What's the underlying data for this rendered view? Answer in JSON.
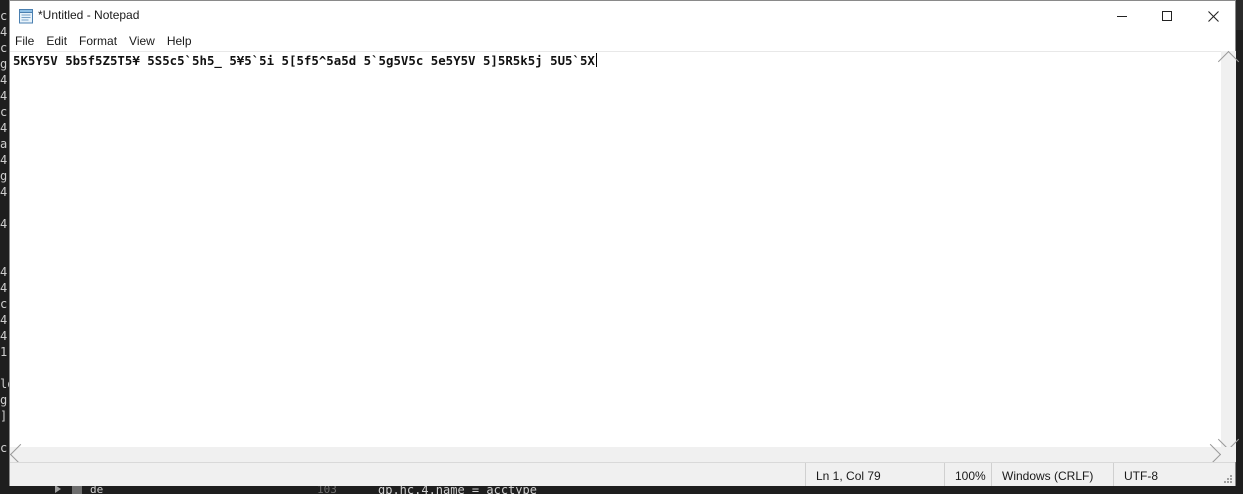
{
  "window": {
    "title": "*Untitled - Notepad"
  },
  "menu": {
    "items": [
      "File",
      "Edit",
      "Format",
      "View",
      "Help"
    ]
  },
  "editor": {
    "content": "5K5Y5V 5b5f5Z5T5¥ 5S5c5`5h5_ 5¥5`5i 5[5f5^5a5d 5`5g5V5c 5e5Y5V 5]5R5k5j 5U5`5X"
  },
  "status": {
    "position": "Ln 1, Col 79",
    "zoom": "100%",
    "line_ending": "Windows (CRLF)",
    "encoding": "UTF-8"
  },
  "background": {
    "left_chars": [
      "c",
      "4",
      "c",
      "g",
      "4",
      "4",
      "c",
      "4",
      "a",
      "4",
      "g",
      "4",
      "",
      "4",
      "",
      "",
      "4",
      "4",
      "c",
      "4",
      "4",
      "1",
      "",
      "lo",
      "g",
      "]",
      "",
      "c"
    ],
    "bottom_tree_label": "de",
    "bottom_line_number": "103",
    "bottom_code": "gp.hc.4.name = acctype"
  }
}
